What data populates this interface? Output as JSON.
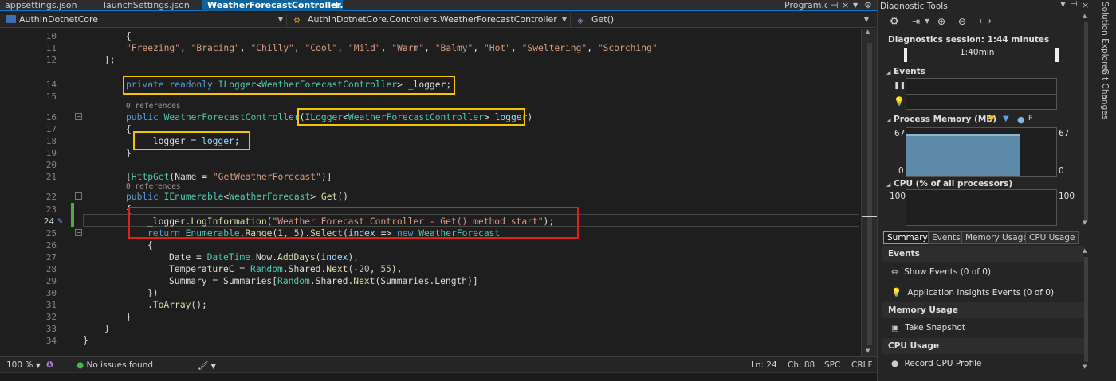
{
  "tabs": [
    {
      "label": "appsettings.json"
    },
    {
      "label": "launchSettings.json"
    },
    {
      "label": "WeatherForecastController.cs"
    },
    {
      "label": "Program.cs"
    }
  ],
  "navbar": {
    "project": "AuthInDotnetCore",
    "type": "AuthInDotnetCore.Controllers.WeatherForecastController",
    "member": "Get()"
  },
  "editor": {
    "line_numbers": [
      "10",
      "11",
      "12",
      "",
      "14",
      "15",
      "",
      "16",
      "17",
      "18",
      "19",
      "20",
      "21",
      "",
      "22",
      "23",
      "24",
      "25",
      "26",
      "27",
      "28",
      "29",
      "30",
      "31",
      "32",
      "33",
      "34"
    ],
    "code_lens": {
      "refs1": "0 references",
      "refs2": "0 references"
    }
  },
  "colors": {
    "highlight_yellow": "#f5c400",
    "highlight_red": "#e0201c",
    "accent": "#0078d4"
  },
  "status": {
    "zoom": "100 %",
    "issues": "No issues found",
    "ln": "Ln: 24",
    "ch": "Ch: 88",
    "spc": "SPC",
    "crlf": "CRLF"
  },
  "diag": {
    "title": "Diagnostic Tools",
    "session": "Diagnostics session: 1:44 minutes",
    "timeline_label": "1:40min",
    "events_label": "Events",
    "memory_label": "Process Memory (MB)",
    "memory_max_left": "67",
    "memory_max_right": "67",
    "memory_min_left": "0",
    "memory_min_right": "0",
    "memory_fill": 0.86,
    "cpu_label": "CPU (% of all processors)",
    "cpu_max_left": "100",
    "cpu_max_right": "100",
    "tabs": [
      "Summary",
      "Events",
      "Memory Usage",
      "CPU Usage"
    ],
    "summary": {
      "events_header": "Events",
      "show_events": "Show Events (0 of 0)",
      "ai_events": "Application Insights Events (0 of 0)",
      "memory_header": "Memory Usage",
      "take_snapshot": "Take Snapshot",
      "cpu_header": "CPU Usage",
      "record_cpu": "Record CPU Profile"
    }
  },
  "rail": {
    "solution_explorer": "Solution Explorer",
    "git_changes": "Git Changes"
  }
}
